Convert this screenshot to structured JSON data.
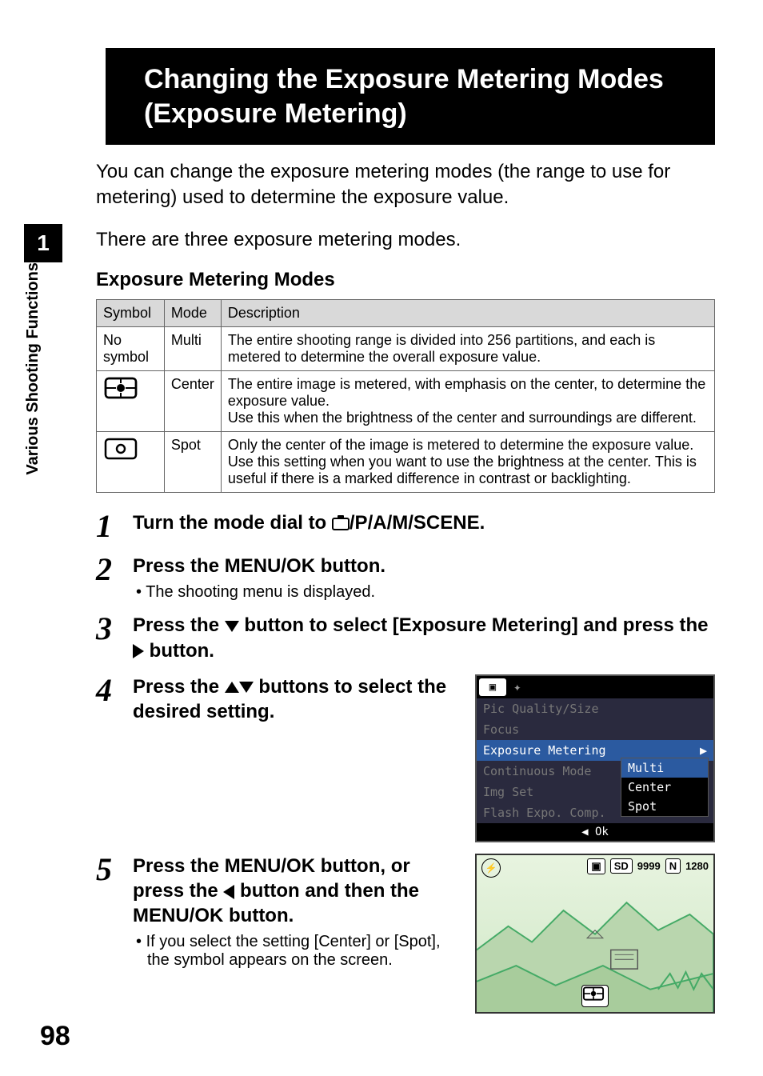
{
  "side": {
    "section_number": "1",
    "section_label": "Various Shooting Functions"
  },
  "page_number": "98",
  "title": "Changing the Exposure Metering Modes (Exposure Metering)",
  "intro_p1": "You can change the exposure metering modes (the range to use for metering) used to determine the exposure value.",
  "intro_p2": "There are three exposure metering modes.",
  "sub_heading": "Exposure Metering Modes",
  "table": {
    "headers": {
      "symbol": "Symbol",
      "mode": "Mode",
      "description": "Description"
    },
    "rows": [
      {
        "symbol_text": "No symbol",
        "mode": "Multi",
        "description": "The entire shooting range is divided into 256 partitions, and each is metered to determine the overall exposure value."
      },
      {
        "symbol_text": "",
        "mode": "Center",
        "description": "The entire image is metered, with emphasis on the center, to determine the exposure value.\nUse this when the brightness of the center and surroundings are different."
      },
      {
        "symbol_text": "",
        "mode": "Spot",
        "description": "Only the center of the image is metered to determine the exposure value. Use this setting when you want to use the brightness at the center. This is useful if there is a marked difference in contrast or backlighting."
      }
    ]
  },
  "steps": {
    "s1": {
      "num": "1",
      "pre": "Turn the mode dial to ",
      "post": "/P/A/M/SCENE."
    },
    "s2": {
      "num": "2",
      "title": "Press the MENU/OK button.",
      "sub": "The shooting menu is displayed."
    },
    "s3": {
      "num": "3",
      "pre": "Press the ",
      "mid": " button to select [Exposure Metering] and press the ",
      "post": " button."
    },
    "s4": {
      "num": "4",
      "pre": "Press the ",
      "post": " buttons to select the desired setting."
    },
    "s5": {
      "num": "5",
      "pre": "Press the MENU/OK button, or press the ",
      "post": " button and then the MENU/OK button.",
      "sub": "If you select the setting [Center] or [Spot], the symbol appears on the screen."
    }
  },
  "menu_screenshot": {
    "items": {
      "pic_quality": "Pic Quality/Size",
      "focus": "Focus",
      "exposure_metering": "Exposure Metering",
      "continuous": "Continuous Mode",
      "img_set": "Img Set",
      "flash_exp": "Flash Expo. Comp."
    },
    "options": {
      "multi": "Multi",
      "center": "Center",
      "spot": "Spot"
    },
    "footer_pre": "◀ ",
    "footer_label": "Ok"
  },
  "landscape_screenshot": {
    "sd_label": "SD",
    "sd_count": "9999",
    "n_label": "N",
    "n_size": "1280"
  }
}
